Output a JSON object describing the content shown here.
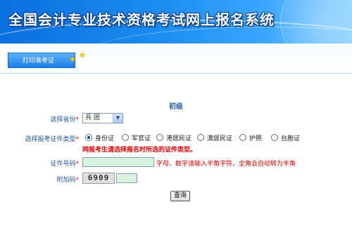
{
  "banner": {
    "title": "全国会计专业技术资格考试网上报名系统"
  },
  "tabs": {
    "print_ticket": "打印准考证"
  },
  "form": {
    "level_heading": "初级",
    "province_label": "选择省份",
    "province_value": "兵 团",
    "cert_type_label": "选择报考证件类型",
    "cert_types": [
      "身份证",
      "军官证",
      "港居民证",
      "澳居民证",
      "护照",
      "台胞证"
    ],
    "cert_selected": "身份证",
    "cert_warning": "网报考生请选择报名时所选的证件类型。",
    "cert_number_label": "证件号码",
    "cert_number_value": "",
    "cert_number_hint": "字母、数字请输入半角字符，全角会自动转为半角",
    "code_label": "附加码",
    "captcha_text": "6909",
    "code_value": "",
    "required_mark": "*",
    "submit_label": "查询"
  },
  "colors": {
    "banner": "#1c8cf0",
    "label": "#1f5aa0",
    "warning": "#e60000",
    "input_bg": "#d8f3df"
  }
}
